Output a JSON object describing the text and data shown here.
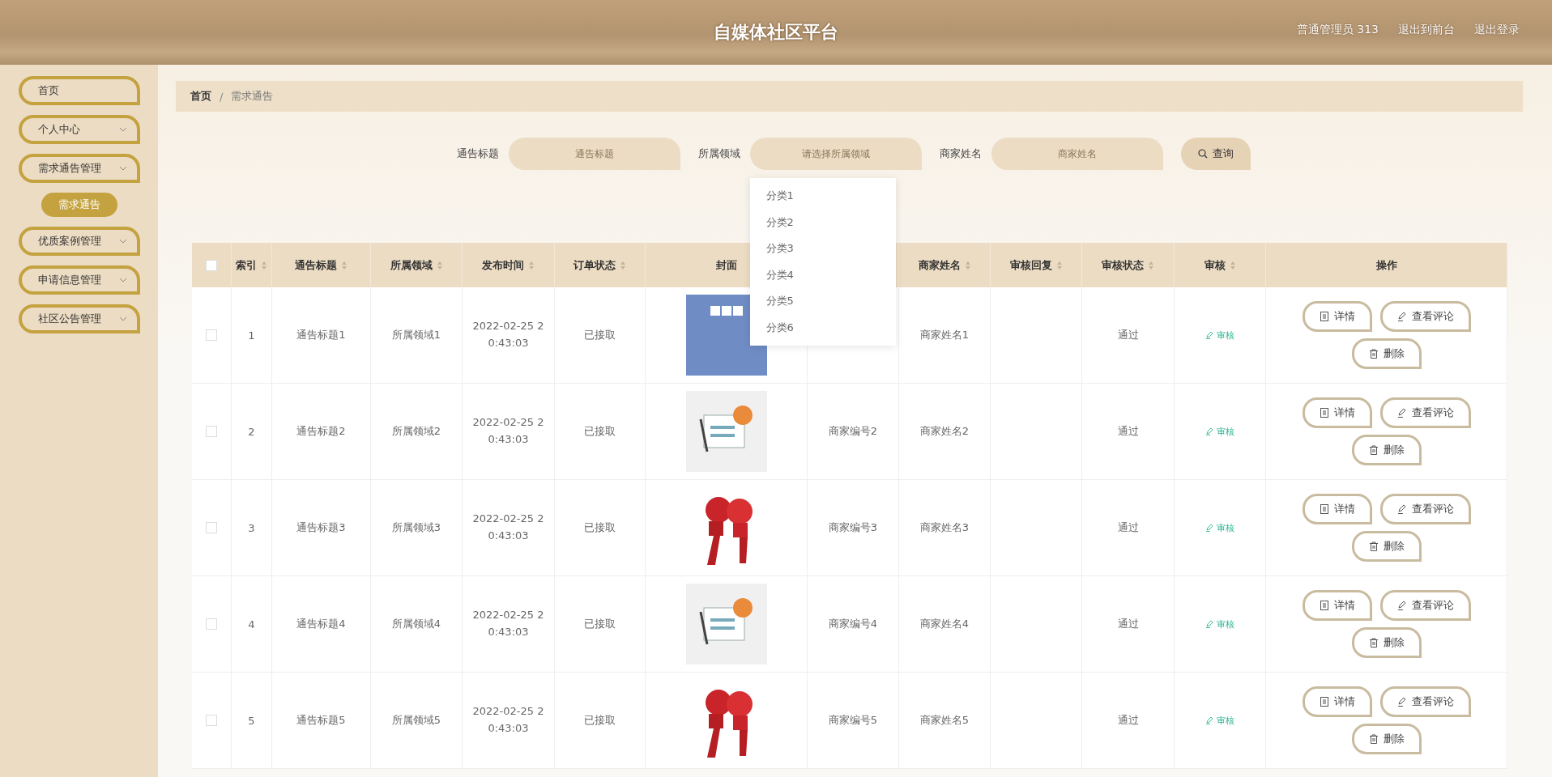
{
  "header": {
    "title": "自媒体社区平台",
    "user": "普通管理员 313",
    "links": [
      "退出到前台",
      "退出登录"
    ]
  },
  "sidebar": {
    "items": [
      {
        "label": "首页",
        "kind": "link"
      },
      {
        "label": "个人中心",
        "kind": "menu"
      },
      {
        "label": "需求通告管理",
        "kind": "menu",
        "children": [
          {
            "label": "需求通告",
            "selected": true
          }
        ]
      },
      {
        "label": "优质案例管理",
        "kind": "menu"
      },
      {
        "label": "申请信息管理",
        "kind": "menu"
      },
      {
        "label": "社区公告管理",
        "kind": "menu"
      }
    ]
  },
  "breadcrumb": {
    "items": [
      "首页",
      "需求通告"
    ],
    "separator": "/"
  },
  "search": {
    "fields": [
      {
        "label": "通告标题",
        "placeholder": "通告标题",
        "kind": "input"
      },
      {
        "label": "所属领域",
        "placeholder": "请选择所属领域",
        "kind": "select"
      },
      {
        "label": "商家姓名",
        "placeholder": "商家姓名",
        "kind": "input"
      }
    ],
    "button": "查询"
  },
  "dropdown": {
    "options": [
      {
        "label": "分类1",
        "selected": false
      },
      {
        "label": "分类2",
        "selected": false
      },
      {
        "label": "分类3",
        "selected": false
      },
      {
        "label": "分类4",
        "selected": false
      },
      {
        "label": "分类5",
        "selected": false
      },
      {
        "label": "分类6",
        "selected": false
      }
    ]
  },
  "table": {
    "header_checked": false,
    "columns": [
      {
        "label": "索引",
        "sortable": true
      },
      {
        "label": "通告标题",
        "sortable": true
      },
      {
        "label": "所属领域",
        "sortable": true
      },
      {
        "label": "发布时间",
        "sortable": true
      },
      {
        "label": "订单状态",
        "sortable": true
      },
      {
        "label": "封面"
      },
      {
        "label": "商家姓名",
        "sortable": true
      },
      {
        "label": "审核回复",
        "sortable": true
      },
      {
        "label": "审核状态",
        "sortable": true
      },
      {
        "label": "审核",
        "sortable": true
      },
      {
        "label": "操作"
      }
    ],
    "rows": [
      {
        "checked": false,
        "index": "1",
        "title": "通告标题1",
        "domain": "所属领域1",
        "time": "2022-02-25 20:43:03",
        "order_status": "已接取",
        "cover": {
          "kind": "tv-logo"
        },
        "merchant_name": "商家姓名1",
        "review_status": "通过",
        "review_link": "审核",
        "actions": [
          "详情",
          "查看评论",
          "删除"
        ]
      },
      {
        "checked": false,
        "index": "2",
        "title": "通告标题2",
        "domain": "所属领域2",
        "time": "2022-02-25 20:43:03",
        "order_status": "已接取",
        "cover": {
          "kind": "news"
        },
        "merchant_no": "商家编号2",
        "merchant_name": "商家姓名2",
        "review_status": "通过",
        "review_link": "审核",
        "actions": [
          "详情",
          "查看评论",
          "删除"
        ]
      },
      {
        "checked": false,
        "index": "3",
        "title": "通告标题3",
        "domain": "所属领域3",
        "time": "2022-02-25 20:43:03",
        "order_status": "已接取",
        "cover": {
          "kind": "microphones"
        },
        "merchant_no": "商家编号3",
        "merchant_name": "商家姓名3",
        "review_status": "通过",
        "review_link": "审核",
        "actions": [
          "详情",
          "查看评论",
          "删除"
        ]
      },
      {
        "checked": false,
        "index": "4",
        "title": "通告标题4",
        "domain": "所属领域4",
        "time": "2022-02-25 20:43:03",
        "order_status": "已接取",
        "cover": {
          "kind": "news"
        },
        "merchant_no": "商家编号4",
        "merchant_name": "商家姓名4",
        "review_status": "通过",
        "review_link": "审核",
        "actions": [
          "详情",
          "查看评论",
          "删除"
        ]
      },
      {
        "checked": false,
        "index": "5",
        "title": "通告标题5",
        "domain": "所属领域5",
        "time": "2022-02-25 20:43:03",
        "order_status": "已接取",
        "cover": {
          "kind": "microphones"
        },
        "merchant_no": "商家编号5",
        "merchant_name": "商家姓名5",
        "review_status": "通过",
        "review_link": "审核",
        "actions": [
          "详情",
          "查看评论",
          "删除"
        ]
      }
    ]
  }
}
